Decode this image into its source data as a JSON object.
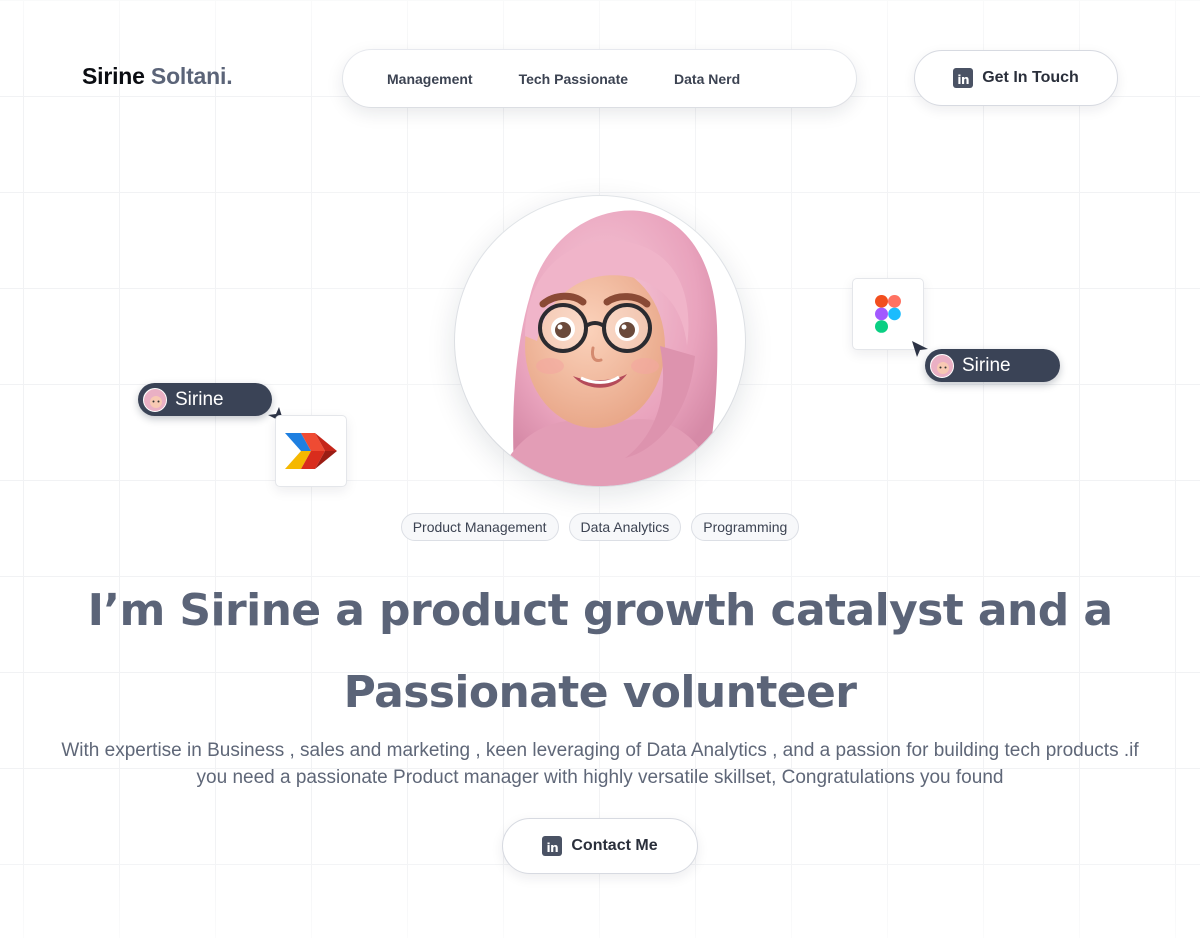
{
  "brand": {
    "first": "Sirine",
    "last": "Soltani."
  },
  "nav": {
    "items": [
      "Management",
      "Tech Passionate",
      "Data Nerd"
    ]
  },
  "header_cta": {
    "label": "Get In Touch",
    "icon": "linkedin-icon"
  },
  "avatar": {
    "icon": "avatar-illustration"
  },
  "collab_pills": {
    "left_name": "Sirine",
    "right_name": "Sirine"
  },
  "tool_icons": {
    "right": "figma-icon",
    "left": "arrow-logo-icon"
  },
  "tags": [
    "Product Management",
    "Data Analytics",
    "Programming"
  ],
  "hero": {
    "headline_line1": "I’m Sirine a product growth catalyst and a",
    "headline_line2": "Passionate volunteer",
    "subtext": "With expertise in Business , sales and marketing  , keen leveraging of Data Analytics , and a passion for building tech products  .if you need a passionate Product manager with highly versatile skillset, Congratulations you found"
  },
  "contact_cta": {
    "label": "Contact Me",
    "icon": "linkedin-icon"
  },
  "colors": {
    "accent_dark": "#3a4356",
    "text_muted": "#5b6478",
    "figma_red": "#f24e1e",
    "figma_purple": "#a259ff",
    "figma_blue": "#1abcfe",
    "figma_green": "#0acf83"
  }
}
